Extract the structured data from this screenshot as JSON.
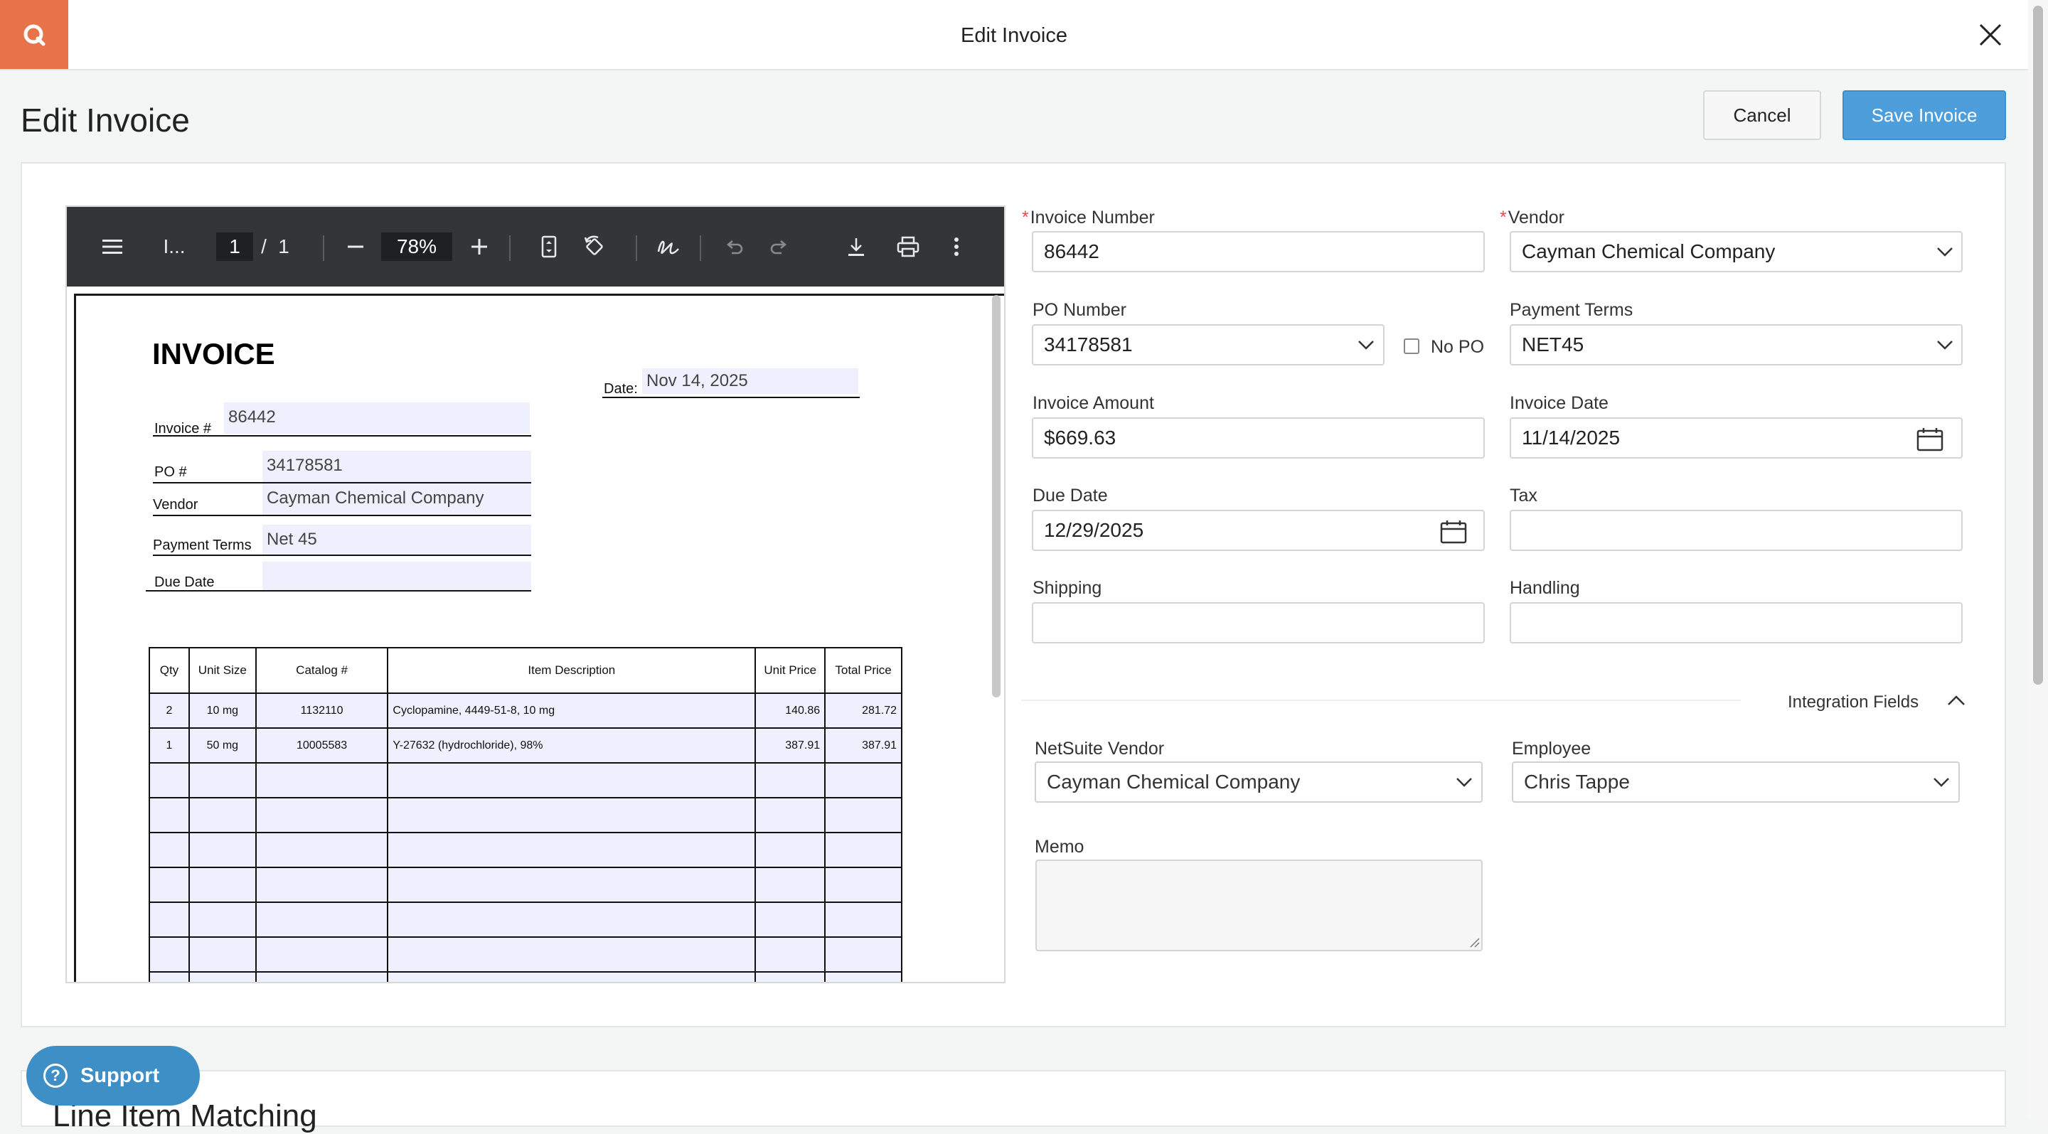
{
  "header": {
    "title": "Edit Invoice"
  },
  "page": {
    "title": "Edit Invoice",
    "cancel_label": "Cancel",
    "save_label": "Save Invoice"
  },
  "viewer": {
    "title_short": "I...",
    "page_current": "1",
    "page_sep": "/",
    "page_total": "1",
    "zoom": "78%",
    "doc": {
      "heading": "INVOICE",
      "date_label": "Date:",
      "date_value": "Nov 14, 2025",
      "invoice_label": "Invoice #",
      "invoice_value": "86442",
      "po_label": "PO #",
      "po_value": "34178581",
      "vendor_label": "Vendor",
      "vendor_value": "Cayman Chemical Company",
      "terms_label": "Payment Terms",
      "terms_value": "Net 45",
      "due_label": "Due Date",
      "due_value": "",
      "table": {
        "headers": [
          "Qty",
          "Unit Size",
          "Catalog #",
          "Item Description",
          "Unit Price",
          "Total Price"
        ],
        "rows": [
          [
            "2",
            "10 mg",
            "1132110",
            "Cyclopamine, 4449-51-8, 10 mg",
            "140.86",
            "281.72"
          ],
          [
            "1",
            "50 mg",
            "10005583",
            "Y-27632 (hydrochloride),  98%",
            "387.91",
            "387.91"
          ]
        ]
      }
    }
  },
  "form": {
    "invoice_number": {
      "label": "Invoice Number",
      "value": "86442"
    },
    "vendor": {
      "label": "Vendor",
      "value": "Cayman Chemical Company"
    },
    "po_number": {
      "label": "PO Number",
      "value": "34178581"
    },
    "no_po": {
      "label": "No PO"
    },
    "payment_terms": {
      "label": "Payment Terms",
      "value": "NET45"
    },
    "invoice_amount": {
      "label": "Invoice Amount",
      "value": "$669.63"
    },
    "invoice_date": {
      "label": "Invoice Date",
      "value": "11/14/2025"
    },
    "due_date": {
      "label": "Due Date",
      "value": "12/29/2025"
    },
    "tax": {
      "label": "Tax",
      "value": ""
    },
    "shipping": {
      "label": "Shipping",
      "value": ""
    },
    "handling": {
      "label": "Handling",
      "value": ""
    },
    "integration_fields": {
      "label": "Integration Fields"
    },
    "netsuite_vendor": {
      "label": "NetSuite Vendor",
      "value": "Cayman Chemical Company"
    },
    "employee": {
      "label": "Employee",
      "value": "Chris Tappe"
    },
    "memo": {
      "label": "Memo",
      "value": ""
    }
  },
  "support": {
    "label": "Support"
  },
  "line_item_matching": {
    "title": "Line Item Matching"
  }
}
